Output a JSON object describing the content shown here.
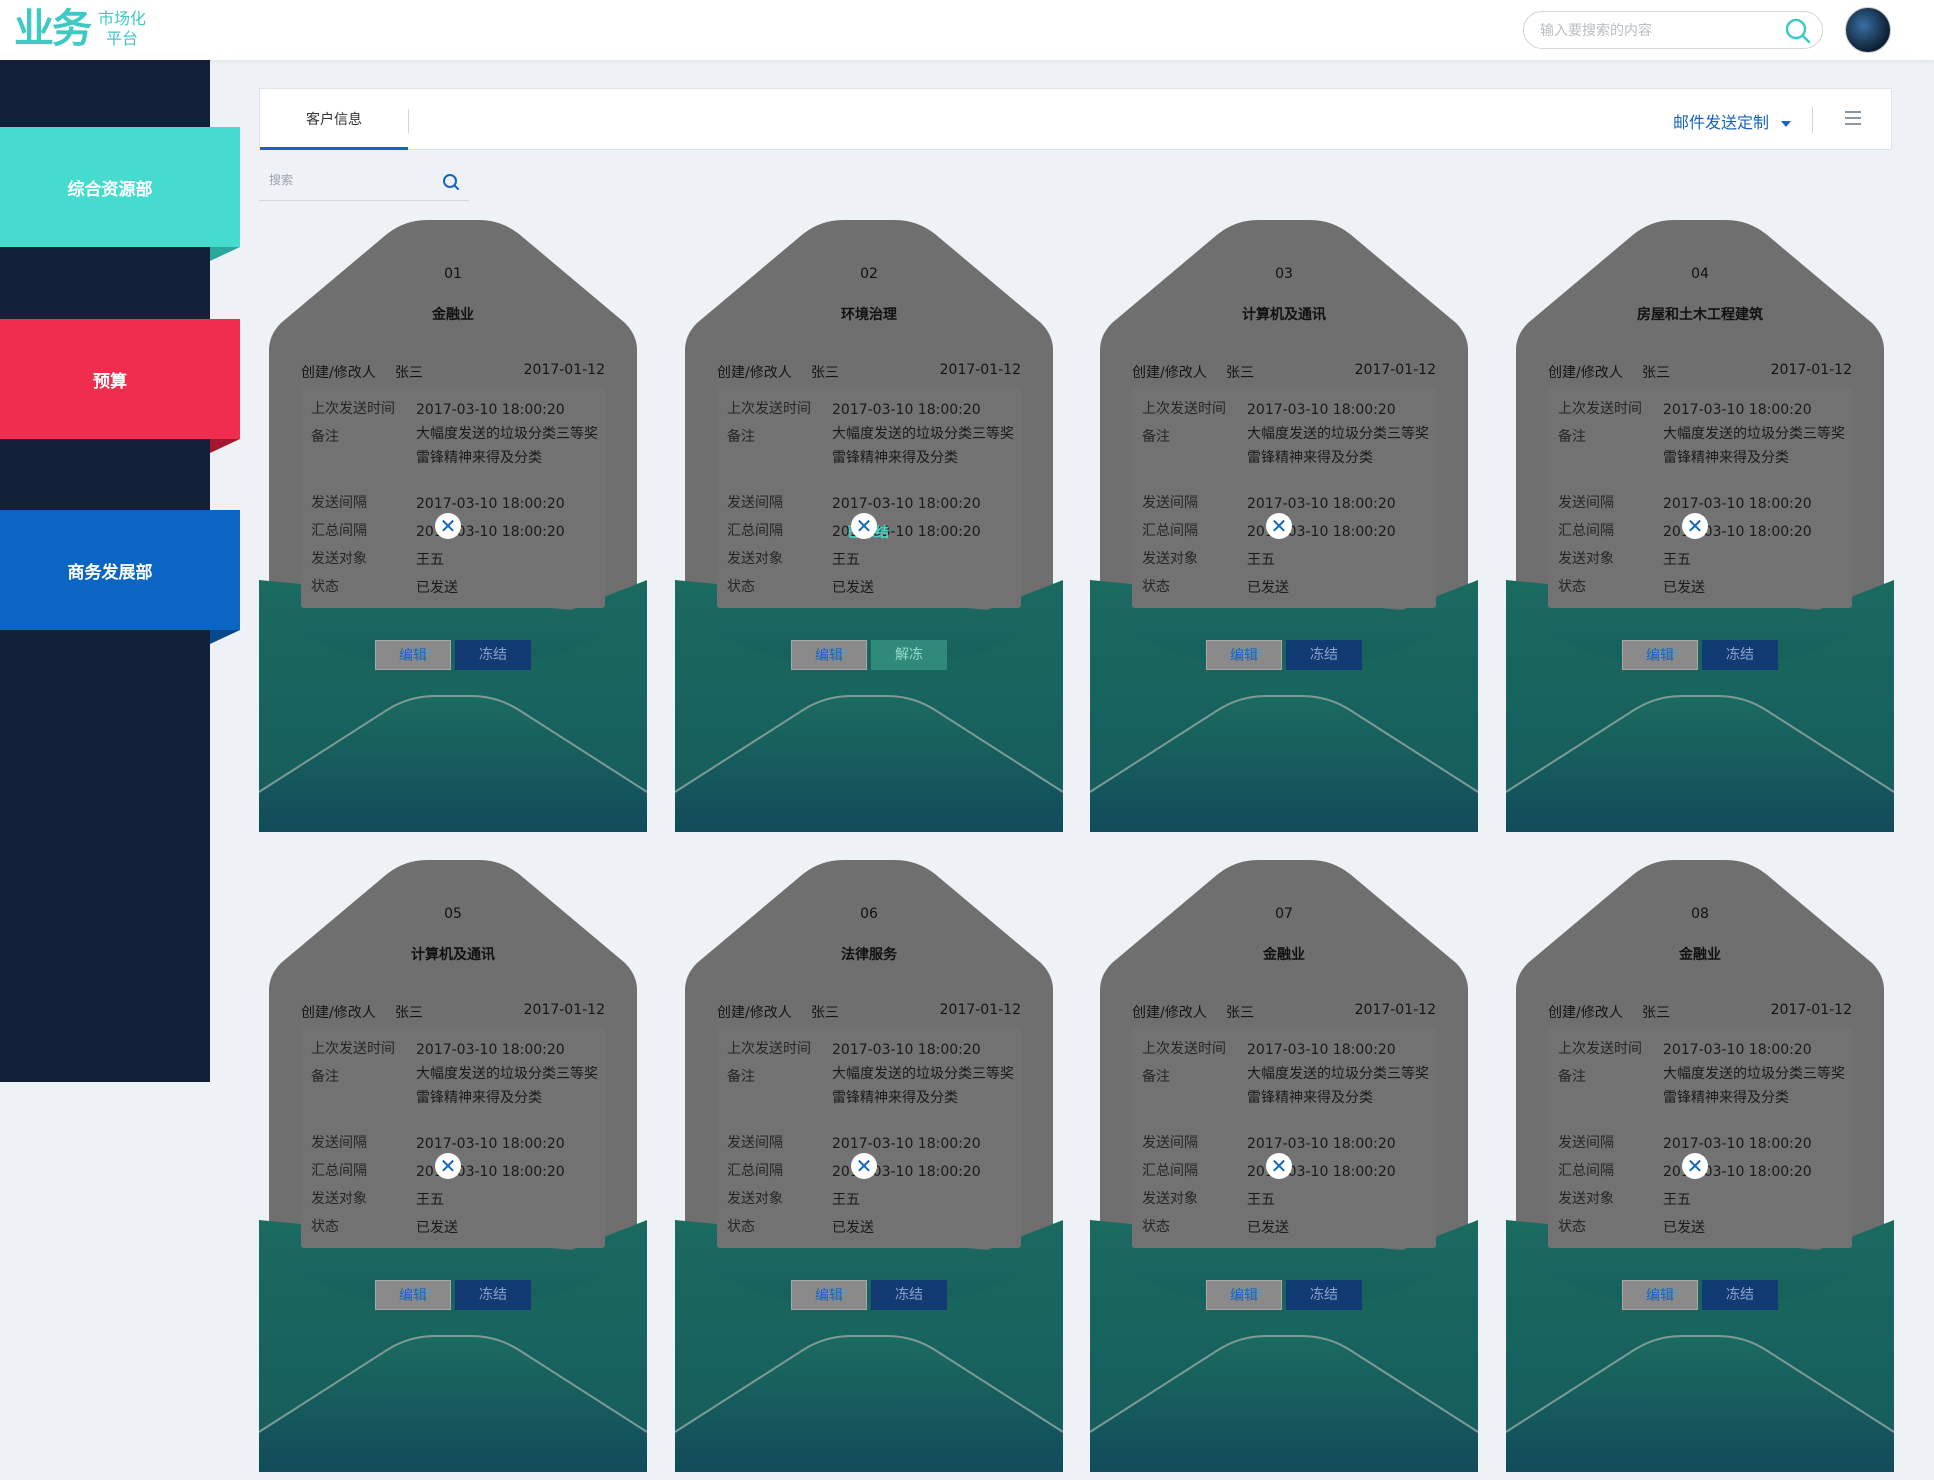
{
  "header": {
    "logo_mark": "业务",
    "logo_sub_line1": "市场化",
    "logo_sub_line2": "平台",
    "search_placeholder": "输入要搜索的内容"
  },
  "sidebar": {
    "items": [
      {
        "label": "综合资源部",
        "color": "#45dccf",
        "fold": "#2aa79d"
      },
      {
        "label": "预算",
        "color": "#f02c4f",
        "fold": "#a6162f"
      },
      {
        "label": "商务发展部",
        "color": "#0a66c2",
        "fold": "#064a8c"
      }
    ]
  },
  "tabs": {
    "active": "客户信息",
    "mail_custom": "邮件发送定制"
  },
  "filter": {
    "placeholder": "搜索"
  },
  "labels": {
    "creator": "创建/修改人",
    "last_send": "上次发送时间",
    "remark": "备注",
    "send_interval": "发送间隔",
    "summary_interval": "汇总间隔",
    "send_target": "发送对象",
    "status": "状态",
    "edit": "编辑",
    "freeze": "冻结",
    "unfreeze": "解冻",
    "frozen_tag": "已冻结"
  },
  "cards": [
    {
      "num": "01",
      "category": "金融业",
      "creator": "张三",
      "date": "2017-01-12",
      "last_send": "2017-03-10 18:00:20",
      "remark": "大幅度发送的垃圾分类三等奖雷锋精神来得及分类",
      "send_interval": "2017-03-10 18:00:20",
      "summary_interval": "2017-03-10 18:00:20",
      "target": "王五",
      "status": "已发送",
      "frozen": false
    },
    {
      "num": "02",
      "category": "环境治理",
      "creator": "张三",
      "date": "2017-01-12",
      "last_send": "2017-03-10 18:00:20",
      "remark": "大幅度发送的垃圾分类三等奖雷锋精神来得及分类",
      "send_interval": "2017-03-10 18:00:20",
      "summary_interval": "2017-03-10 18:00:20",
      "target": "王五",
      "status": "已发送",
      "frozen": true
    },
    {
      "num": "03",
      "category": "计算机及通讯",
      "creator": "张三",
      "date": "2017-01-12",
      "last_send": "2017-03-10 18:00:20",
      "remark": "大幅度发送的垃圾分类三等奖雷锋精神来得及分类",
      "send_interval": "2017-03-10 18:00:20",
      "summary_interval": "2017-03-10 18:00:20",
      "target": "王五",
      "status": "已发送",
      "frozen": false
    },
    {
      "num": "04",
      "category": "房屋和土木工程建筑",
      "creator": "张三",
      "date": "2017-01-12",
      "last_send": "2017-03-10 18:00:20",
      "remark": "大幅度发送的垃圾分类三等奖雷锋精神来得及分类",
      "send_interval": "2017-03-10 18:00:20",
      "summary_interval": "2017-03-10 18:00:20",
      "target": "王五",
      "status": "已发送",
      "frozen": false
    },
    {
      "num": "05",
      "category": "计算机及通讯",
      "creator": "张三",
      "date": "2017-01-12",
      "last_send": "2017-03-10 18:00:20",
      "remark": "大幅度发送的垃圾分类三等奖雷锋精神来得及分类",
      "send_interval": "2017-03-10 18:00:20",
      "summary_interval": "2017-03-10 18:00:20",
      "target": "王五",
      "status": "已发送",
      "frozen": false
    },
    {
      "num": "06",
      "category": "法律服务",
      "creator": "张三",
      "date": "2017-01-12",
      "last_send": "2017-03-10 18:00:20",
      "remark": "大幅度发送的垃圾分类三等奖雷锋精神来得及分类",
      "send_interval": "2017-03-10 18:00:20",
      "summary_interval": "2017-03-10 18:00:20",
      "target": "王五",
      "status": "已发送",
      "frozen": false
    },
    {
      "num": "07",
      "category": "金融业",
      "creator": "张三",
      "date": "2017-01-12",
      "last_send": "2017-03-10 18:00:20",
      "remark": "大幅度发送的垃圾分类三等奖雷锋精神来得及分类",
      "send_interval": "2017-03-10 18:00:20",
      "summary_interval": "2017-03-10 18:00:20",
      "target": "王五",
      "status": "已发送",
      "frozen": false
    },
    {
      "num": "08",
      "category": "金融业",
      "creator": "张三",
      "date": "2017-01-12",
      "last_send": "2017-03-10 18:00:20",
      "remark": "大幅度发送的垃圾分类三等奖雷锋精神来得及分类",
      "send_interval": "2017-03-10 18:00:20",
      "summary_interval": "2017-03-10 18:00:20",
      "target": "王五",
      "status": "已发送",
      "frozen": false
    }
  ]
}
